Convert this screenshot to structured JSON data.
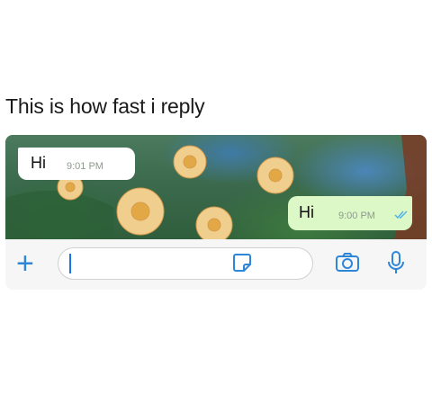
{
  "caption": "This is how fast i reply",
  "chat": {
    "incoming": {
      "text": "Hi",
      "time": "9:01 PM"
    },
    "outgoing": {
      "text": "Hi",
      "time": "9:00 PM",
      "status": "read"
    }
  },
  "input": {
    "value": "",
    "placeholder": ""
  },
  "icons": {
    "attach": "plus-icon",
    "sticker": "sticker-icon",
    "camera": "camera-icon",
    "microphone": "microphone-icon",
    "read_receipt": "double-check-icon"
  },
  "colors": {
    "accent": "#2e86d9",
    "outgoing_bubble": "#dcf8c6",
    "incoming_bubble": "#ffffff",
    "read_ticks": "#4fb3e8"
  }
}
